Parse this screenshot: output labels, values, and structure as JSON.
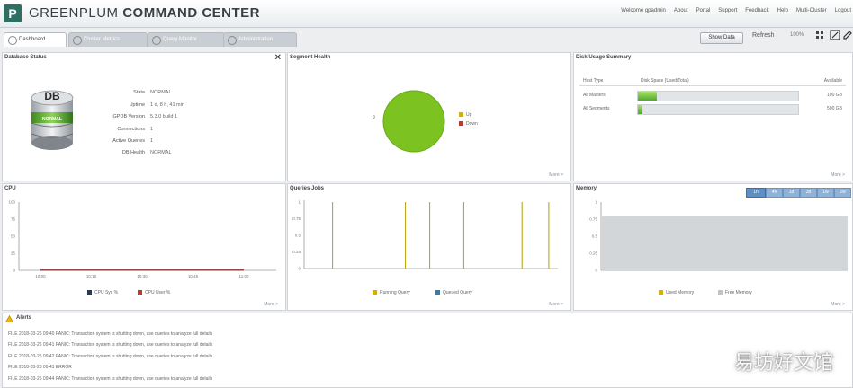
{
  "header": {
    "logo_letter": "P",
    "brand_light": "GREENPLUM ",
    "brand_bold": "COMMAND CENTER",
    "nav": [
      "Welcome gpadmin",
      "About",
      "Portal",
      "Support",
      "Feedback",
      "Help",
      "Multi-Cluster",
      "Logout"
    ]
  },
  "tabs": [
    {
      "label": "Dashboard",
      "active": true
    },
    {
      "label": "Cluster Metrics",
      "active": false
    },
    {
      "label": "Query Monitor",
      "active": false
    },
    {
      "label": "Administration",
      "active": false
    }
  ],
  "toolbar": {
    "view_button": "Show Data",
    "refresh_label": "Refresh",
    "zoom_label": "100%"
  },
  "db_status": {
    "title": "Database Status",
    "db_label": "DB",
    "badge": "NORMAL",
    "fields": [
      {
        "key": "State",
        "value": "NORMAL"
      },
      {
        "key": "Uptime",
        "value": "1 d, 8 h, 41 min"
      },
      {
        "key": "GPDB Version",
        "value": "5.3.0 build 1"
      },
      {
        "key": "Connections",
        "value": "1"
      },
      {
        "key": "Active Queries",
        "value": "1"
      },
      {
        "key": "DB Health",
        "value": "NORMAL"
      }
    ]
  },
  "segment_health": {
    "title": "Segment Health",
    "slice_label": "9",
    "legend": [
      {
        "name": "Up",
        "color": "#7cc220"
      },
      {
        "name": "Down",
        "color": "#c0392b"
      }
    ],
    "footer": "More >"
  },
  "disk_usage": {
    "title": "Disk Usage Summary",
    "columns": [
      "Host Type",
      "Disk Space (Used/Total)",
      "Available"
    ],
    "rows": [
      {
        "type": "All Masters",
        "used_fraction": 0.12,
        "available": "100 GB"
      },
      {
        "type": "All Segments",
        "used_fraction": 0.03,
        "available": "500 GB"
      }
    ],
    "footer": "More >"
  },
  "cpu_panel": {
    "title": "CPU",
    "footer": "More >",
    "legend": [
      {
        "name": "CPU Sys %",
        "color": "#1f3d5c"
      },
      {
        "name": "CPU User %",
        "color": "#c0392b"
      }
    ]
  },
  "queries_panel": {
    "title": "Queries Jobs",
    "footer": "More >",
    "legend": [
      {
        "name": "Running Query",
        "color": "#d4b000"
      },
      {
        "name": "Queued Query",
        "color": "#3a7ca5"
      }
    ]
  },
  "memory_panel": {
    "title": "Memory",
    "footer": "More >",
    "range_buttons": [
      "1h",
      "4h",
      "1d",
      "3d",
      "1w",
      "2w"
    ],
    "legend": [
      {
        "name": "Used Memory",
        "color": "#d4b000"
      },
      {
        "name": "Free Memory",
        "color": "#bfc4c9"
      }
    ]
  },
  "alerts": {
    "title": "Alerts",
    "lines": [
      "FILE 2018-03-26 09:40 PANIC: Transaction system is shutting down, use queries to analyze full details",
      "FILE 2018-03-26 09:41 PANIC: Transaction system is shutting down, use queries to analyze full details",
      "FILE 2018-03-26 09:42 PANIC: Transaction system is shutting down, use queries to analyze full details",
      "FILE 2018-03-26 09:43 ERROR",
      "FILE 2018-03-26 09:44 PANIC: Transaction system is shutting down, use queries to analyze full details"
    ]
  },
  "watermark": "易坊好文馆",
  "chart_data": [
    {
      "type": "line",
      "x": [
        "10:00",
        "10:15",
        "10:30",
        "10:45",
        "11:00"
      ],
      "series": [
        {
          "name": "CPU Sys %",
          "values": [
            0,
            0,
            0,
            0,
            0
          ]
        },
        {
          "name": "CPU User %",
          "values": [
            0,
            0,
            0,
            0,
            0
          ]
        }
      ],
      "ylim": [
        0,
        100
      ]
    },
    {
      "type": "bar",
      "spikes": [
        0.08,
        0.38,
        0.48,
        0.62,
        0.86,
        0.97
      ],
      "series": [
        {
          "name": "Running Query",
          "values": [
            1,
            1,
            1,
            1,
            1,
            1
          ]
        },
        {
          "name": "Queued Query",
          "values": [
            0,
            0,
            0,
            0,
            0,
            0
          ]
        }
      ],
      "ylim": [
        0,
        1
      ]
    },
    {
      "type": "area",
      "series": [
        {
          "name": "Used Memory",
          "values": [
            0.8,
            0.8,
            0.8,
            0.8,
            0.8
          ]
        },
        {
          "name": "Free Memory",
          "values": [
            0.2,
            0.2,
            0.2,
            0.2,
            0.2
          ]
        }
      ],
      "ylim": [
        0,
        1
      ]
    }
  ]
}
